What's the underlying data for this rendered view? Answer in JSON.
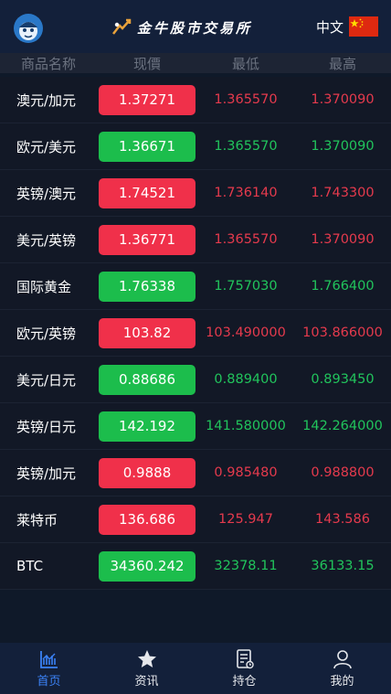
{
  "header": {
    "brand_text": "金牛股市交易所",
    "language": "中文"
  },
  "columns": [
    "商品名称",
    "现價",
    "最低",
    "最高"
  ],
  "rows": [
    {
      "name": "澳元/加元",
      "price": "1.37271",
      "low": "1.365570",
      "high": "1.370090",
      "trend": "down"
    },
    {
      "name": "欧元/美元",
      "price": "1.36671",
      "low": "1.365570",
      "high": "1.370090",
      "trend": "up"
    },
    {
      "name": "英镑/澳元",
      "price": "1.74521",
      "low": "1.736140",
      "high": "1.743300",
      "trend": "down"
    },
    {
      "name": "美元/英镑",
      "price": "1.36771",
      "low": "1.365570",
      "high": "1.370090",
      "trend": "down"
    },
    {
      "name": "国际黄金",
      "price": "1.76338",
      "low": "1.757030",
      "high": "1.766400",
      "trend": "up"
    },
    {
      "name": "欧元/英镑",
      "price": "103.82",
      "low": "103.490000",
      "high": "103.866000",
      "trend": "down"
    },
    {
      "name": "美元/日元",
      "price": "0.88686",
      "low": "0.889400",
      "high": "0.893450",
      "trend": "up"
    },
    {
      "name": "英镑/日元",
      "price": "142.192",
      "low": "141.580000",
      "high": "142.264000",
      "trend": "up"
    },
    {
      "name": "英镑/加元",
      "price": "0.9888",
      "low": "0.985480",
      "high": "0.988800",
      "trend": "down"
    },
    {
      "name": "莱特币",
      "price": "136.686",
      "low": "125.947",
      "high": "143.586",
      "trend": "down"
    },
    {
      "name": "BTC",
      "price": "34360.242",
      "low": "32378.11",
      "high": "36133.15",
      "trend": "up"
    }
  ],
  "tabs": [
    {
      "label": "首页",
      "icon": "chart-icon",
      "active": true
    },
    {
      "label": "资讯",
      "icon": "star-icon",
      "active": false
    },
    {
      "label": "持仓",
      "icon": "document-icon",
      "active": false
    },
    {
      "label": "我的",
      "icon": "user-icon",
      "active": false
    }
  ],
  "colors": {
    "up": "#1cbd4c",
    "down": "#f0304a",
    "active_tab": "#3b82f6",
    "background": "#0f1929"
  }
}
